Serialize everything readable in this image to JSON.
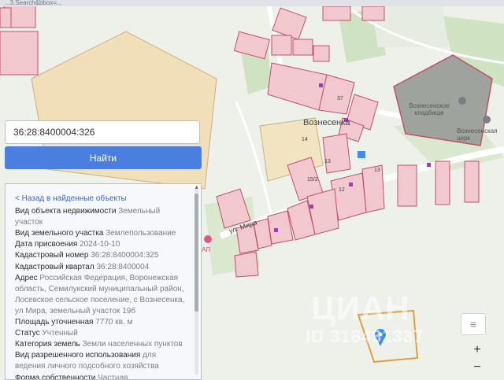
{
  "browser": {
    "url_fragment": "...3.Search&bbox=..."
  },
  "search": {
    "value": "36:28:8400004:326",
    "button_label": "Найти"
  },
  "map": {
    "village_label": "Вознесенка",
    "street_label": "ул. Мира",
    "cemetery_label": "Вознесенское кладбище",
    "church_label": "Вознесенская церк",
    "clinic_label": "АП",
    "parcel_numbers": [
      "37",
      "14",
      "13",
      "13",
      "12",
      "15/2"
    ]
  },
  "info": {
    "back_link": "< Назад в найденные объекты",
    "rows": [
      {
        "key": "Вид объекта недвижимости",
        "value": "Земельный участок"
      },
      {
        "key": "Вид земельного участка",
        "value": "Землепользование"
      },
      {
        "key": "Дата присвоения",
        "value": "2024-10-10"
      },
      {
        "key": "Кадастровый номер",
        "value": "36:28:8400004:325"
      },
      {
        "key": "Кадастровый квартал",
        "value": "36:28:8400004"
      },
      {
        "key": "Адрес",
        "value": "Российская Федерация, Воронежская область, Семилукский муниципальный район, Лосевское сельское поселение, с Вознесенка, ул Мира, земельный участок 19б"
      },
      {
        "key": "Площадь уточненная",
        "value": "7770 кв. м"
      },
      {
        "key": "Статус",
        "value": "Учтенный"
      },
      {
        "key": "Категория земель",
        "value": "Земли населенных пунктов"
      },
      {
        "key": "Вид разрешенного использования",
        "value": "для ведения личного подсобного хозяйства"
      },
      {
        "key": "Форма собственности",
        "value": "Частная"
      }
    ]
  },
  "controls": {
    "zoom_in": "+",
    "zoom_out": "−",
    "layers_icon": "layers-icon"
  },
  "watermark": {
    "brand": "ЦИАН",
    "id": "ID 318431337"
  },
  "colors": {
    "button": "#4a7fe0",
    "parcel_stroke": "#c0506a",
    "parcel_fill": "#f2c8cf",
    "highlight": "#e0a040",
    "map_bg": "#eef1ea"
  }
}
